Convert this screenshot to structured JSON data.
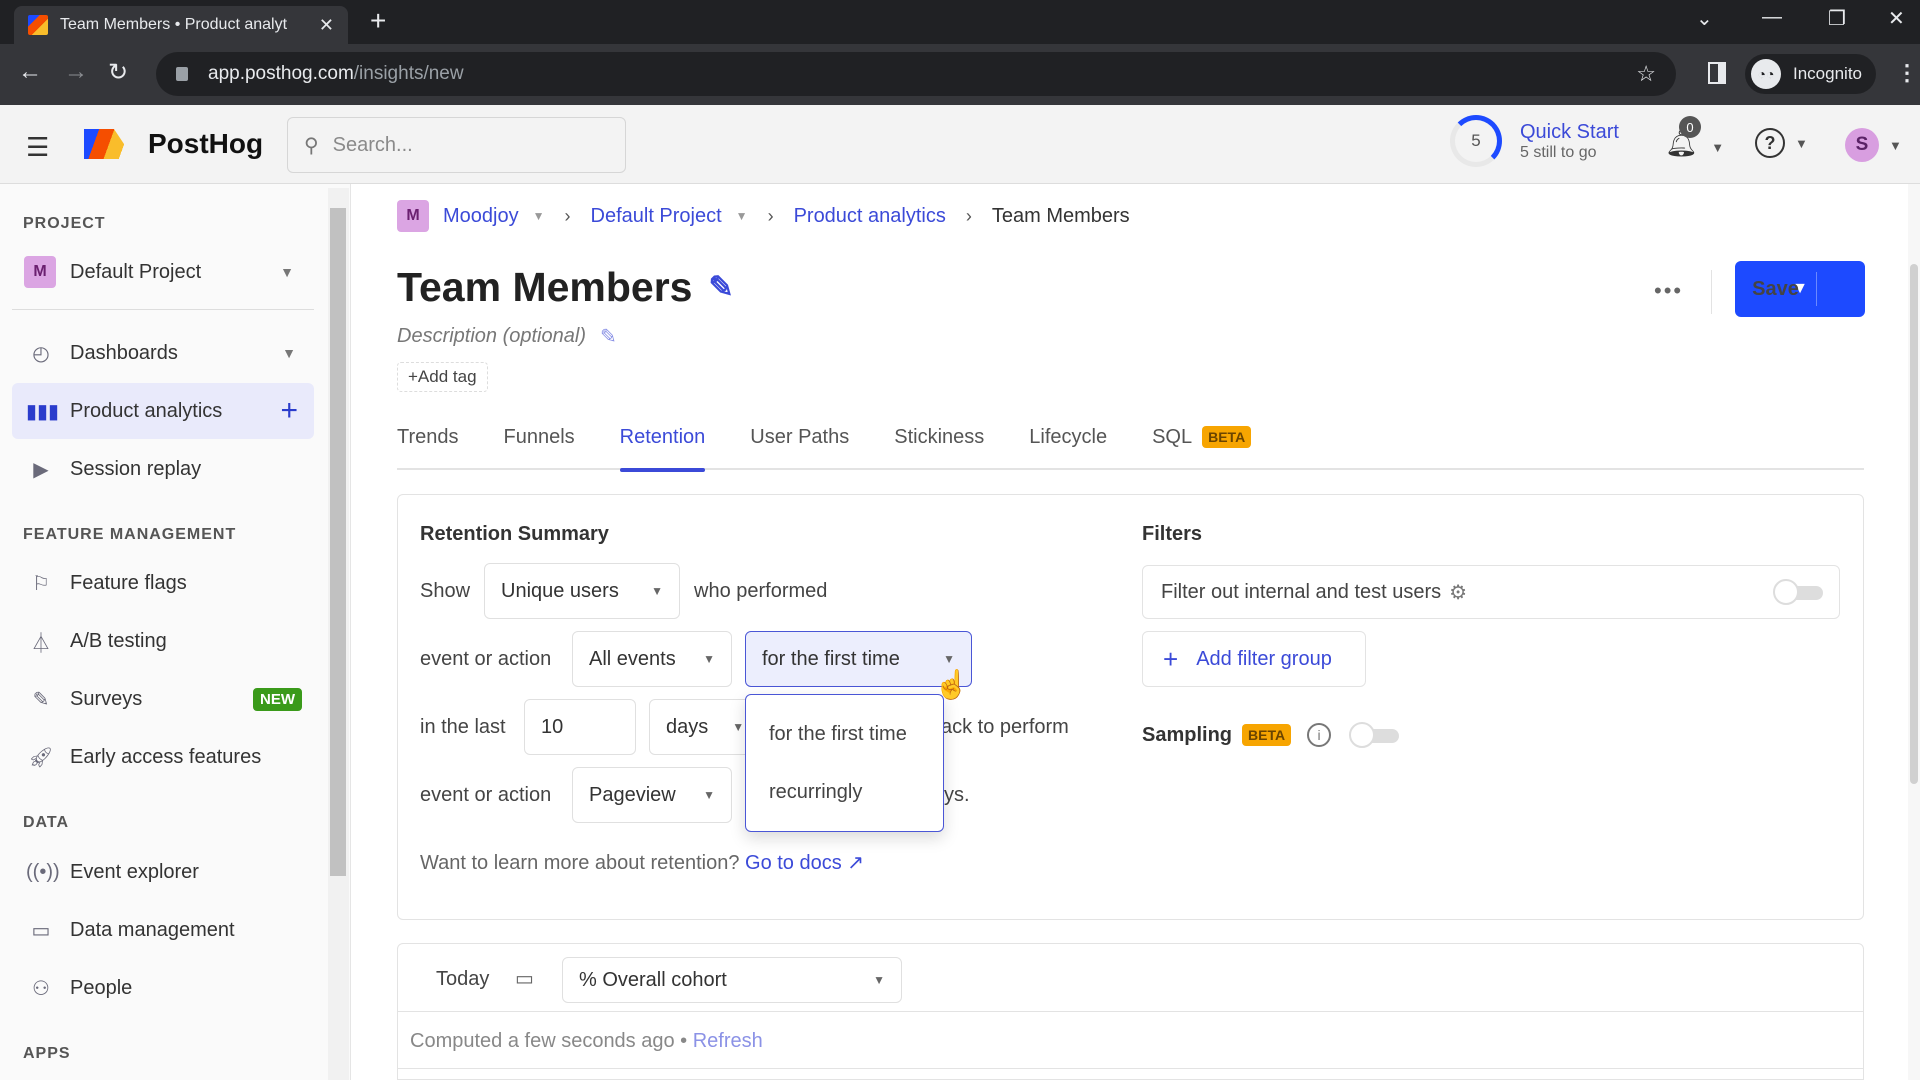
{
  "browser": {
    "tab_title": "Team Members • Product analyt",
    "url_domain": "app.posthog.com",
    "url_path": "/insights/new",
    "profile_label": "Incognito"
  },
  "header": {
    "brand": "PostHog",
    "search_placeholder": "Search...",
    "quick_start": {
      "count": "5",
      "title": "Quick Start",
      "subtitle": "5 still to go",
      "progress_fraction": 0.3
    },
    "notifications_count": "0",
    "avatar_initial": "S"
  },
  "sidebar": {
    "project_section": "PROJECT",
    "project_initial": "M",
    "project_name": "Default Project",
    "items": [
      {
        "label": "Dashboards"
      },
      {
        "label": "Product analytics"
      },
      {
        "label": "Session replay"
      }
    ],
    "feature_section": "FEATURE MANAGEMENT",
    "feature_items": [
      {
        "label": "Feature flags"
      },
      {
        "label": "A/B testing"
      },
      {
        "label": "Surveys",
        "badge": "NEW"
      },
      {
        "label": "Early access features"
      }
    ],
    "data_section": "DATA",
    "data_items": [
      {
        "label": "Event explorer"
      },
      {
        "label": "Data management"
      },
      {
        "label": "People"
      }
    ],
    "apps_section": "APPS"
  },
  "breadcrumb": {
    "org_initial": "M",
    "items": [
      "Moodjoy",
      "Default Project",
      "Product analytics",
      "Team Members"
    ]
  },
  "page": {
    "title": "Team Members",
    "description_placeholder": "Description (optional)",
    "add_tag": "+Add tag",
    "more": "•••",
    "save_label": "Save"
  },
  "tabs": [
    {
      "label": "Trends"
    },
    {
      "label": "Funnels"
    },
    {
      "label": "Retention",
      "active": true
    },
    {
      "label": "User Paths"
    },
    {
      "label": "Stickiness"
    },
    {
      "label": "Lifecycle"
    },
    {
      "label": "SQL",
      "badge": "BETA"
    }
  ],
  "retention": {
    "heading": "Retention Summary",
    "show_label": "Show",
    "show_value": "Unique users",
    "who_performed": "who performed",
    "event_label_1": "event or action",
    "event_value_1": "All events",
    "period_value": "for the first time",
    "in_the_last": "in the last",
    "number_value": "10",
    "unit_value": "days",
    "came_back_fragment": "ack to perform",
    "event_label_2": "event or action",
    "event_value_2": "Pageview",
    "trailing_fragment": "ys.",
    "learn_more": "Want to learn more about retention?",
    "docs_link": "Go to docs",
    "dropdown_options": [
      "for the first time",
      "recurringly"
    ]
  },
  "filters": {
    "heading": "Filters",
    "internal_filter": "Filter out internal and test users",
    "internal_filter_on": false,
    "add_filter_group": "Add filter group",
    "sampling": "Sampling",
    "sampling_badge": "BETA",
    "sampling_on": false
  },
  "results": {
    "date": "Today",
    "cohort_select": "% Overall cohort",
    "computed": "Computed a few seconds ago",
    "refresh": "Refresh"
  }
}
